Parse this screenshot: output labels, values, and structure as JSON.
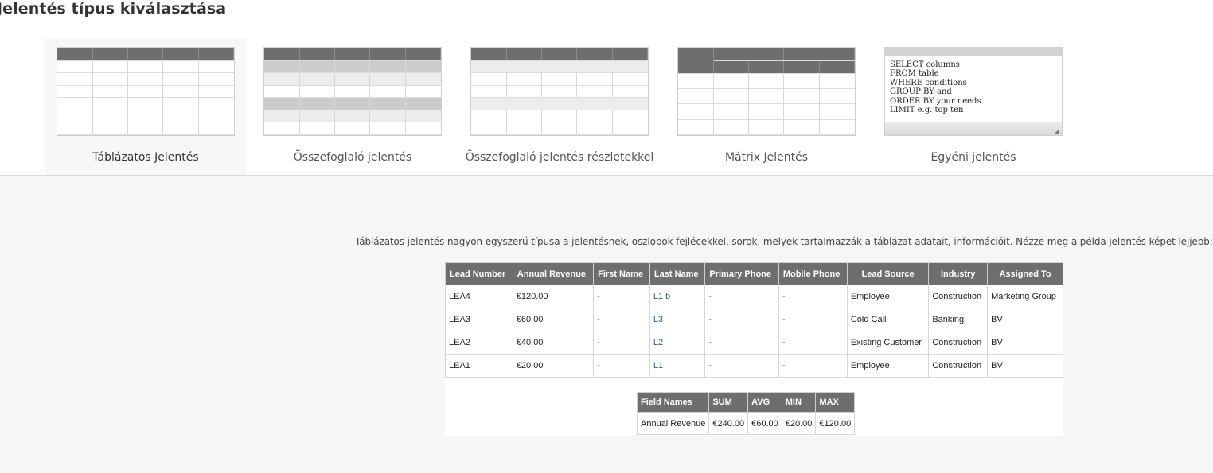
{
  "page_title": "Jelentés típus kiválasztása",
  "report_types": [
    {
      "label": "Táblázatos Jelentés",
      "active": true
    },
    {
      "label": "Összefoglaló jelentés",
      "active": false
    },
    {
      "label": "Összefoglaló jelentés részletekkel",
      "active": false
    },
    {
      "label": "Mátrix Jelentés",
      "active": false
    },
    {
      "label": "Egyéni jelentés",
      "active": false
    }
  ],
  "sql_preview": "SELECT columns\nFROM table\nWHERE conditions\nGROUP BY and\nORDER BY your needs\nLIMIT e.g. top ten",
  "description": "Táblázatos jelentés nagyon egyszerű típusa a jelentésnek, oszlopok fejlécekkel, sorok, melyek tartalmazzák a táblázat adatait, információit. Nézze meg a példa jelentés képet lejjebb:",
  "sample_table": {
    "headers": [
      "Lead Number",
      "Annual Revenue",
      "First Name",
      "Last Name",
      "Primary Phone",
      "Mobile Phone",
      "Lead Source",
      "Industry",
      "Assigned To"
    ],
    "rows": [
      [
        "LEA4",
        "€120.00",
        "-",
        "L1 b",
        "-",
        "-",
        "Employee",
        "Construction",
        "Marketing Group"
      ],
      [
        "LEA3",
        "€60.00",
        "-",
        "L3",
        "-",
        "-",
        "Cold Call",
        "Banking",
        "BV"
      ],
      [
        "LEA2",
        "€40.00",
        "-",
        "L2",
        "-",
        "-",
        "Existing Customer",
        "Construction",
        "BV"
      ],
      [
        "LEA1",
        "€20.00",
        "-",
        "L1",
        "-",
        "-",
        "Employee",
        "Construction",
        "BV"
      ]
    ]
  },
  "summary_table": {
    "headers": [
      "Field Names",
      "SUM",
      "AVG",
      "MIN",
      "MAX"
    ],
    "rows": [
      [
        "Annual Revenue",
        "€240.00",
        "€60.00",
        "€20.00",
        "€120.00"
      ]
    ]
  },
  "colors": {
    "header_bg": "#6e6e6e",
    "link": "#2a5aa8",
    "content_bg": "#f6f6f6",
    "active_tab_bg": "#f7f7f7"
  }
}
